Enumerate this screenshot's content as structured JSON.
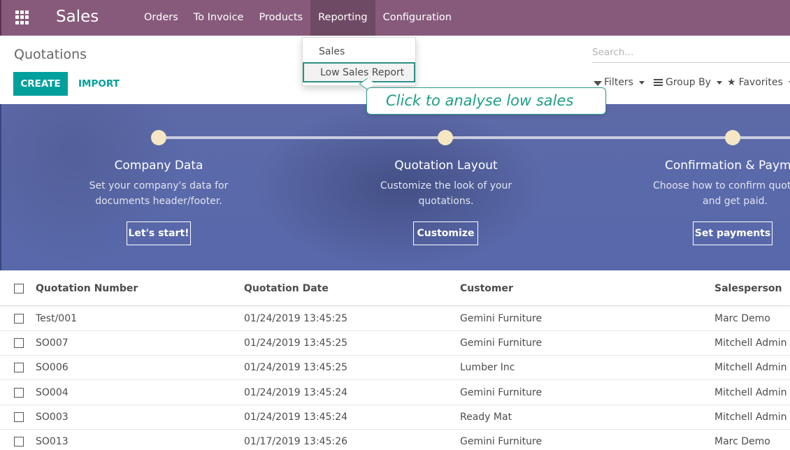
{
  "navbar": {
    "brand": "Sales",
    "menu": [
      {
        "label": "Orders"
      },
      {
        "label": "To Invoice"
      },
      {
        "label": "Products"
      },
      {
        "label": "Reporting",
        "active": true
      },
      {
        "label": "Configuration"
      }
    ]
  },
  "reporting_dropdown": {
    "items": [
      {
        "label": "Sales"
      },
      {
        "label": "Low Sales Report",
        "highlighted": true
      }
    ]
  },
  "tooltip": {
    "text": "Click to analyse low sales"
  },
  "control_panel": {
    "breadcrumb": "Quotations",
    "create_label": "CREATE",
    "import_label": "IMPORT",
    "search_placeholder": "Search...",
    "filters_label": "Filters",
    "group_by_label": "Group By",
    "favorites_label": "Favorites"
  },
  "onboarding": {
    "steps": [
      {
        "title": "Company Data",
        "desc_line1": "Set your company's data for",
        "desc_line2": "documents header/footer.",
        "button": "Let's start!"
      },
      {
        "title": "Quotation Layout",
        "desc_line1": "Customize the look of your",
        "desc_line2": "quotations.",
        "button": "Customize"
      },
      {
        "title": "Confirmation & Paymen",
        "desc_line1": "Choose how to confirm quotat",
        "desc_line2": "and get paid.",
        "button": "Set payments"
      }
    ]
  },
  "table": {
    "columns": [
      "Quotation Number",
      "Quotation Date",
      "Customer",
      "Salesperson"
    ],
    "rows": [
      {
        "number": "Test/001",
        "date": "01/24/2019 13:45:25",
        "customer": "Gemini Furniture",
        "salesperson": "Marc Demo"
      },
      {
        "number": "SO007",
        "date": "01/24/2019 13:45:25",
        "customer": "Gemini Furniture",
        "salesperson": "Mitchell Admin"
      },
      {
        "number": "SO006",
        "date": "01/24/2019 13:45:25",
        "customer": "Lumber Inc",
        "salesperson": "Mitchell Admin"
      },
      {
        "number": "SO004",
        "date": "01/24/2019 13:45:24",
        "customer": "Gemini Furniture",
        "salesperson": "Mitchell Admin"
      },
      {
        "number": "SO003",
        "date": "01/24/2019 13:45:24",
        "customer": "Ready Mat",
        "salesperson": "Mitchell Admin"
      },
      {
        "number": "SO013",
        "date": "01/17/2019 13:45:26",
        "customer": "Gemini Furniture",
        "salesperson": "Marc Demo"
      }
    ]
  },
  "colors": {
    "navbar": "#875a7b",
    "primary": "#00a09d",
    "tooltip_accent": "#1f9d86",
    "banner": "#5c6aa8"
  }
}
